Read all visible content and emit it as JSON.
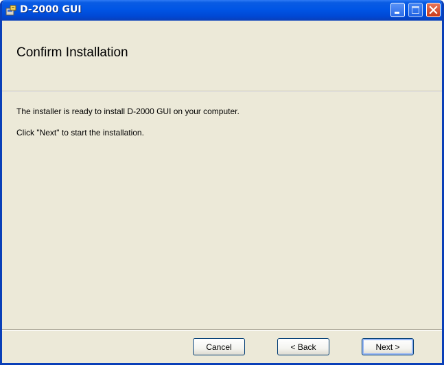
{
  "window": {
    "title": "D-2000 GUI",
    "app_icon": "installer-icon",
    "controls": {
      "minimize": "minimize-icon",
      "maximize": "maximize-icon",
      "close": "close-icon"
    }
  },
  "header": {
    "title": "Confirm Installation"
  },
  "body": {
    "line1": "The installer is ready to install D-2000 GUI on your computer.",
    "line2": "Click \"Next\" to start the installation."
  },
  "buttons": {
    "cancel": "Cancel",
    "back": "< Back",
    "next": "Next >"
  },
  "colors": {
    "titlebar": "#0055e5",
    "window_bg": "#ece9d8",
    "close_button": "#c7381a"
  }
}
